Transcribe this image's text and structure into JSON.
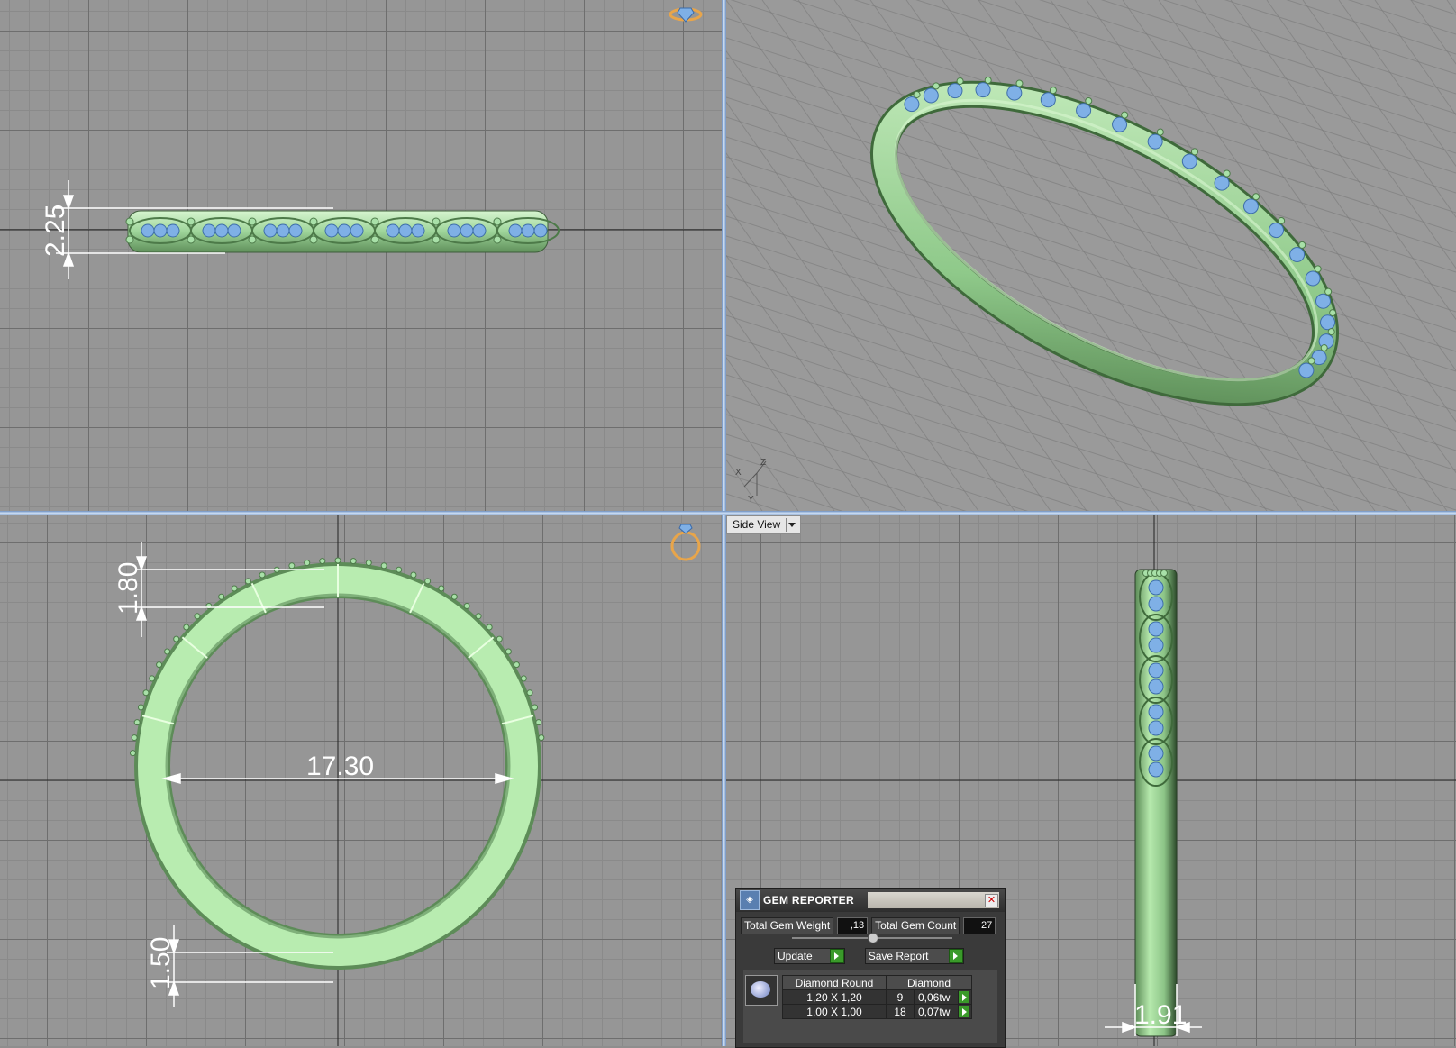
{
  "viewports": {
    "top_left": {
      "dimension": "2.25"
    },
    "top_right": {
      "axis_labels": [
        "X",
        "Z",
        "Y"
      ]
    },
    "bottom_left": {
      "dim_top": "1.80",
      "dim_inner": "17.30",
      "dim_bottom": "1.50"
    },
    "bottom_right": {
      "view_label": "Side View",
      "dimension": "1.91"
    }
  },
  "gem_reporter": {
    "title": "GEM REPORTER",
    "total_weight_label": "Total Gem Weight",
    "total_weight_value": ",13",
    "total_count_label": "Total Gem Count",
    "total_count_value": "27",
    "update_label": "Update",
    "save_report_label": "Save Report",
    "table": {
      "headers": [
        "Diamond Round",
        "Diamond"
      ],
      "rows": [
        {
          "size": "1,20 X 1,20",
          "count": "9",
          "weight": "0,06tw"
        },
        {
          "size": "1,00 X 1,00",
          "count": "18",
          "weight": "0,07tw"
        }
      ]
    }
  },
  "colors": {
    "metal": "#a8e0a8",
    "gem": "#7fb0e6",
    "dimension": "#ffffff",
    "view_icon": "#e8a54a"
  }
}
